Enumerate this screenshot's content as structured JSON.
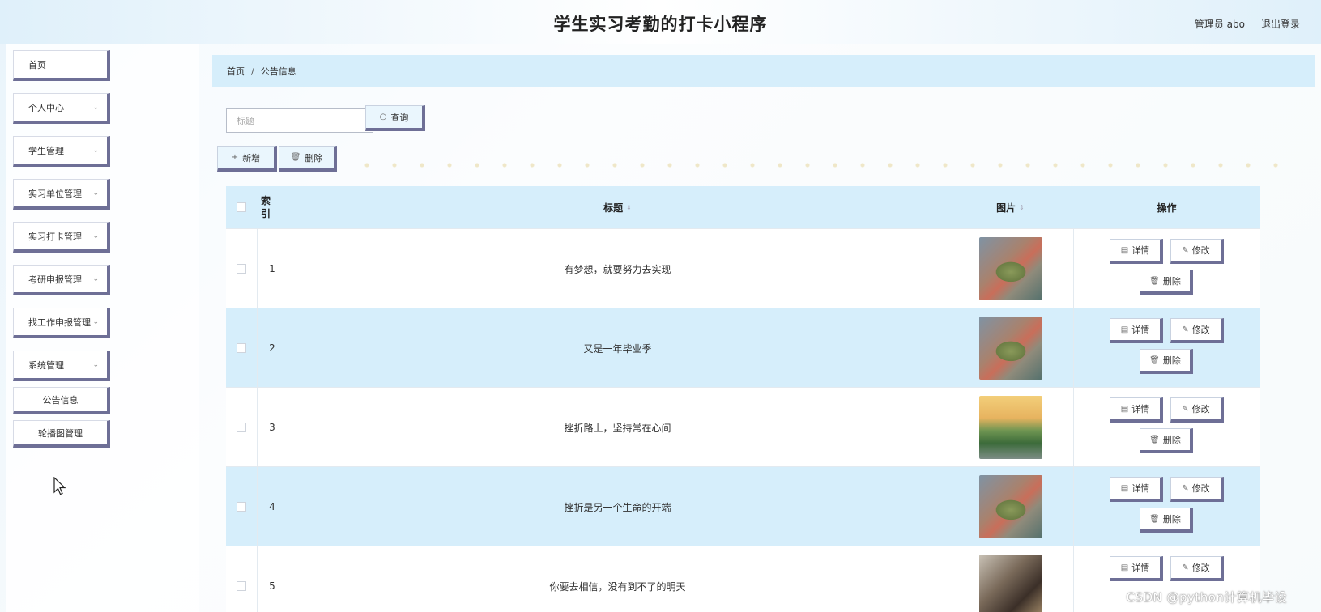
{
  "header": {
    "title": "学生实习考勤的打卡小程序",
    "user": "管理员 abo",
    "logout": "退出登录"
  },
  "sidebar": {
    "items": [
      {
        "label": "首页",
        "has_submenu": false
      },
      {
        "label": "个人中心",
        "has_submenu": true
      },
      {
        "label": "学生管理",
        "has_submenu": true
      },
      {
        "label": "实习单位管理",
        "has_submenu": true
      },
      {
        "label": "实习打卡管理",
        "has_submenu": true
      },
      {
        "label": "考研申报管理",
        "has_submenu": true
      },
      {
        "label": "找工作申报管理",
        "has_submenu": true
      },
      {
        "label": "系统管理",
        "has_submenu": true
      }
    ],
    "subitems": [
      {
        "label": "公告信息"
      },
      {
        "label": "轮播图管理"
      }
    ]
  },
  "breadcrumb": {
    "home": "首页",
    "sep": "/",
    "current": "公告信息"
  },
  "search": {
    "placeholder": "标题",
    "button": "查询"
  },
  "toolbar": {
    "add": "新增",
    "delete": "删除"
  },
  "table": {
    "headers": {
      "index": "索引",
      "title": "标题",
      "image": "图片",
      "ops": "操作"
    },
    "rows": [
      {
        "index": "1",
        "title": "有梦想，就要努力去实现",
        "image": "campus-photo"
      },
      {
        "index": "2",
        "title": "又是一年毕业季",
        "image": "campus-photo"
      },
      {
        "index": "3",
        "title": "挫折路上，坚持常在心间",
        "image": "street-photo"
      },
      {
        "index": "4",
        "title": "挫折是另一个生命的开端",
        "image": "campus-photo"
      },
      {
        "index": "5",
        "title": "你要去相信，没有到不了的明天",
        "image": "room-photo"
      }
    ],
    "ops": {
      "detail": "详情",
      "edit": "修改",
      "delete": "删除"
    }
  },
  "watermark": "CSDN @python计算机毕设",
  "colors": {
    "accent": "#d6eefb",
    "button_shadow": "#6e6f96",
    "header_bg": "#dff0fa"
  }
}
